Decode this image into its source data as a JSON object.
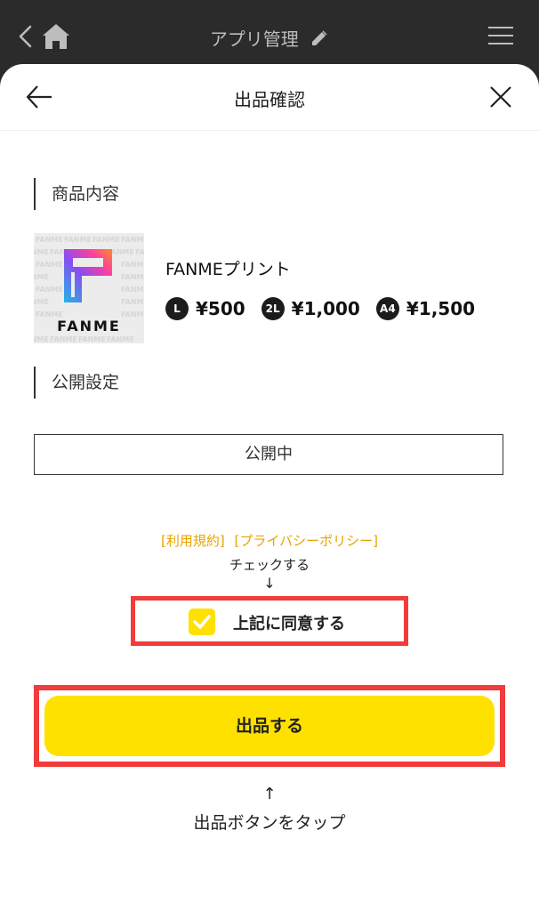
{
  "app_bar": {
    "title": "アプリ管理",
    "icons": [
      "chevron-left-icon",
      "home-icon",
      "pencil-icon",
      "menu-icon"
    ]
  },
  "sheet": {
    "title": "出品確認",
    "icons": [
      "arrow-left-icon",
      "close-icon"
    ]
  },
  "product_section": {
    "label": "商品内容",
    "thumbnail_logo_text": "FANME",
    "name": "FANMEプリント",
    "prices": [
      {
        "badge": "L",
        "price": "¥500"
      },
      {
        "badge": "2L",
        "price": "¥1,000"
      },
      {
        "badge": "A4",
        "price": "¥1,500"
      }
    ]
  },
  "publish_section": {
    "label": "公開設定",
    "value": "公開中"
  },
  "agreement": {
    "terms_link": "[利用規約]",
    "privacy_link": "[プライバシーポリシー]",
    "instruction": "チェックする",
    "arrow": "↓",
    "checkbox_label": "上記に同意する",
    "checked": true
  },
  "submit": {
    "button_label": "出品する",
    "arrow": "↑",
    "instruction": "出品ボタンをタップ"
  },
  "colors": {
    "accent_yellow": "#ffe100",
    "link_orange": "#e8a400",
    "highlight_red": "#f23b3b",
    "appbar_bg": "#2b2b2b"
  }
}
